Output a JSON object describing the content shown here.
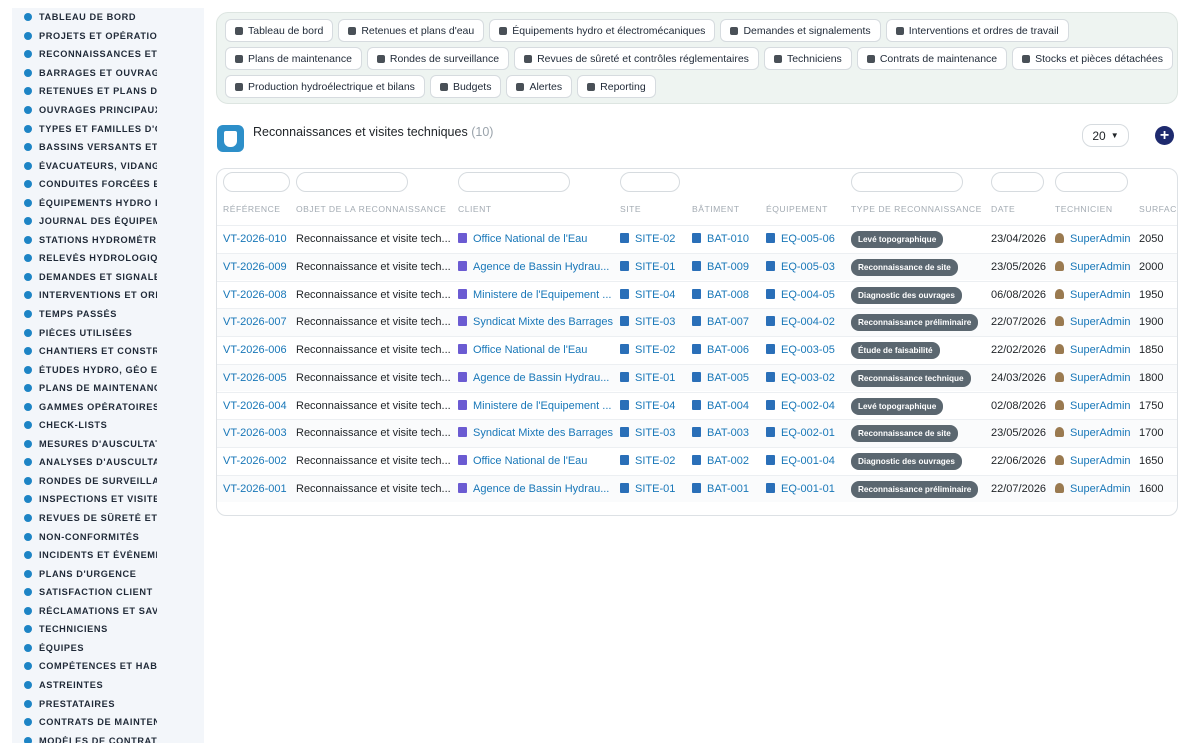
{
  "colors": {
    "sidebar_icon": "#1d84c5",
    "link": "#1877b8",
    "badge": "#5b6770",
    "add_button": "#1e2a6e",
    "nav_bg": "#eef4f1"
  },
  "sidebar": {
    "items": [
      {
        "label": "TABLEAU DE BORD",
        "icon": "dashboard-icon"
      },
      {
        "label": "PROJETS ET OPÉRATION",
        "icon": "target-icon"
      },
      {
        "label": "RECONNAISSANCES ET V",
        "icon": "ruler-icon"
      },
      {
        "label": "BARRAGES ET OUVRAGE",
        "icon": "dam-icon"
      },
      {
        "label": "RETENUES ET PLANS D'E",
        "icon": "building-icon"
      },
      {
        "label": "OUVRAGES PRINCIPAUX",
        "icon": "box-icon"
      },
      {
        "label": "TYPES ET FAMILLES D'OU",
        "icon": "sitemap-icon"
      },
      {
        "label": "BASSINS VERSANTS ET A",
        "icon": "grid-icon"
      },
      {
        "label": "ÉVACUATEURS, VIDANGE",
        "icon": "faucet-icon"
      },
      {
        "label": "CONDUITES FORCÉES ET",
        "icon": "pipe-icon"
      },
      {
        "label": "ÉQUIPEMENTS HYDRO ET",
        "icon": "cogs-icon"
      },
      {
        "label": "JOURNAL DES ÉQUIPEME",
        "icon": "history-icon"
      },
      {
        "label": "STATIONS HYDROMÉTRIC",
        "icon": "broadcast-icon"
      },
      {
        "label": "RELEVÉS HYDROLOGIQU",
        "icon": "table-icon"
      },
      {
        "label": "DEMANDES ET SIGNALEM",
        "icon": "question-icon"
      },
      {
        "label": "INTERVENTIONS ET ORDI",
        "icon": "clipboard-icon"
      },
      {
        "label": "TEMPS PASSÉS",
        "icon": "clock-icon"
      },
      {
        "label": "PIÈCES UTILISÉES",
        "icon": "puzzle-icon"
      },
      {
        "label": "CHANTIERS ET CONSTRU",
        "icon": "hammer-icon"
      },
      {
        "label": "ÉTUDES HYDRO, GÉO ET",
        "icon": "flask-icon"
      },
      {
        "label": "PLANS DE MAINTENANCE",
        "icon": "calendar-icon"
      },
      {
        "label": "GAMMES OPÉRATOIRES",
        "icon": "list-icon"
      },
      {
        "label": "CHECK-LISTS",
        "icon": "checklist-icon"
      },
      {
        "label": "MESURES D'AUSCULTATI",
        "icon": "gauge-icon"
      },
      {
        "label": "ANALYSES D'AUSCULTAT",
        "icon": "chart-icon"
      },
      {
        "label": "RONDES DE SURVEILLAN",
        "icon": "route-icon"
      },
      {
        "label": "INSPECTIONS ET VISITES",
        "icon": "search-icon"
      },
      {
        "label": "REVUES DE SÛRETÉ ET C",
        "icon": "file-check-icon"
      },
      {
        "label": "NON-CONFORMITÉS",
        "icon": "exclamation-icon"
      },
      {
        "label": "INCIDENTS ET ÉVÉNEMEI",
        "icon": "warning-icon"
      },
      {
        "label": "PLANS D'URGENCE",
        "icon": "file-alert-icon"
      },
      {
        "label": "SATISFACTION CLIENT",
        "icon": "smile-icon"
      },
      {
        "label": "RÉCLAMATIONS ET SAV",
        "icon": "bullhorn-icon"
      },
      {
        "label": "TECHNICIENS",
        "icon": "hard-hat-icon"
      },
      {
        "label": "ÉQUIPES",
        "icon": "users-icon"
      },
      {
        "label": "COMPÉTENCES ET HABIL",
        "icon": "star-icon"
      },
      {
        "label": "ASTREINTES",
        "icon": "phone-icon"
      },
      {
        "label": "PRESTATAIRES",
        "icon": "handshake-icon"
      },
      {
        "label": "CONTRATS DE MAINTENA",
        "icon": "contract-icon"
      },
      {
        "label": "MODÈLES DE CONTRATS",
        "icon": "template-icon"
      }
    ]
  },
  "topnav": {
    "row1": [
      {
        "label": "Tableau de bord",
        "icon": "dashboard-icon"
      },
      {
        "label": "Retenues et plans d'eau",
        "icon": "building-icon"
      },
      {
        "label": "Équipements hydro et électromécaniques",
        "icon": "cogs-icon"
      },
      {
        "label": "Demandes et signalements",
        "icon": "question-icon"
      },
      {
        "label": "Interventions et ordres de travail",
        "icon": "clipboard-icon"
      }
    ],
    "row2": [
      {
        "label": "Plans de maintenance",
        "icon": "calendar-icon"
      },
      {
        "label": "Rondes de surveillance",
        "icon": "route-icon"
      },
      {
        "label": "Revues de sûreté et contrôles réglementaires",
        "icon": "file-check-icon"
      },
      {
        "label": "Techniciens",
        "icon": "hard-hat-icon"
      },
      {
        "label": "Contrats de maintenance",
        "icon": "contract-icon"
      },
      {
        "label": "Stocks et pièces détachées",
        "icon": "boxes-icon"
      }
    ],
    "row3": [
      {
        "label": "Production hydroélectrique et bilans",
        "icon": "bolt-icon"
      },
      {
        "label": "Budgets",
        "icon": "money-icon"
      },
      {
        "label": "Alertes",
        "icon": "bell-icon"
      },
      {
        "label": "Reporting",
        "icon": "pie-chart-icon"
      }
    ]
  },
  "page": {
    "title": "Reconnaissances et visites techniques",
    "count": "(10)",
    "per_page": "20",
    "add_label": "+"
  },
  "table": {
    "headers": [
      "RÉFÉRENCE",
      "OBJET DE LA RECONNAISSANCE",
      "CLIENT",
      "SITE",
      "BÂTIMENT",
      "ÉQUIPEMENT",
      "TYPE DE RECONNAISSANCE",
      "DATE",
      "TECHNICIEN",
      "SURFACE"
    ],
    "rows": [
      {
        "ref": "VT-2026-010",
        "objet": "Reconnaissance et visite tech...",
        "client": "Office National de l'Eau",
        "site": "SITE-02",
        "batiment": "BAT-010",
        "equipement": "EQ-005-06",
        "type": "Levé topographique",
        "date": "23/04/2026",
        "technicien": "SuperAdmin",
        "surface": "2050"
      },
      {
        "ref": "VT-2026-009",
        "objet": "Reconnaissance et visite tech...",
        "client": "Agence de Bassin Hydrau...",
        "site": "SITE-01",
        "batiment": "BAT-009",
        "equipement": "EQ-005-03",
        "type": "Reconnaissance de site",
        "date": "23/05/2026",
        "technicien": "SuperAdmin",
        "surface": "2000"
      },
      {
        "ref": "VT-2026-008",
        "objet": "Reconnaissance et visite tech...",
        "client": "Ministere de l'Equipement ...",
        "site": "SITE-04",
        "batiment": "BAT-008",
        "equipement": "EQ-004-05",
        "type": "Diagnostic des ouvrages",
        "date": "06/08/2026",
        "technicien": "SuperAdmin",
        "surface": "1950"
      },
      {
        "ref": "VT-2026-007",
        "objet": "Reconnaissance et visite tech...",
        "client": "Syndicat Mixte des Barrages",
        "site": "SITE-03",
        "batiment": "BAT-007",
        "equipement": "EQ-004-02",
        "type": "Reconnaissance préliminaire",
        "date": "22/07/2026",
        "technicien": "SuperAdmin",
        "surface": "1900"
      },
      {
        "ref": "VT-2026-006",
        "objet": "Reconnaissance et visite tech...",
        "client": "Office National de l'Eau",
        "site": "SITE-02",
        "batiment": "BAT-006",
        "equipement": "EQ-003-05",
        "type": "Étude de faisabilité",
        "date": "22/02/2026",
        "technicien": "SuperAdmin",
        "surface": "1850"
      },
      {
        "ref": "VT-2026-005",
        "objet": "Reconnaissance et visite tech...",
        "client": "Agence de Bassin Hydrau...",
        "site": "SITE-01",
        "batiment": "BAT-005",
        "equipement": "EQ-003-02",
        "type": "Reconnaissance technique",
        "date": "24/03/2026",
        "technicien": "SuperAdmin",
        "surface": "1800"
      },
      {
        "ref": "VT-2026-004",
        "objet": "Reconnaissance et visite tech...",
        "client": "Ministere de l'Equipement ...",
        "site": "SITE-04",
        "batiment": "BAT-004",
        "equipement": "EQ-002-04",
        "type": "Levé topographique",
        "date": "02/08/2026",
        "technicien": "SuperAdmin",
        "surface": "1750"
      },
      {
        "ref": "VT-2026-003",
        "objet": "Reconnaissance et visite tech...",
        "client": "Syndicat Mixte des Barrages",
        "site": "SITE-03",
        "batiment": "BAT-003",
        "equipement": "EQ-002-01",
        "type": "Reconnaissance de site",
        "date": "23/05/2026",
        "technicien": "SuperAdmin",
        "surface": "1700"
      },
      {
        "ref": "VT-2026-002",
        "objet": "Reconnaissance et visite tech...",
        "client": "Office National de l'Eau",
        "site": "SITE-02",
        "batiment": "BAT-002",
        "equipement": "EQ-001-04",
        "type": "Diagnostic des ouvrages",
        "date": "22/06/2026",
        "technicien": "SuperAdmin",
        "surface": "1650"
      },
      {
        "ref": "VT-2026-001",
        "objet": "Reconnaissance et visite tech...",
        "client": "Agence de Bassin Hydrau...",
        "site": "SITE-01",
        "batiment": "BAT-001",
        "equipement": "EQ-001-01",
        "type": "Reconnaissance préliminaire",
        "date": "22/07/2026",
        "technicien": "SuperAdmin",
        "surface": "1600"
      }
    ]
  }
}
